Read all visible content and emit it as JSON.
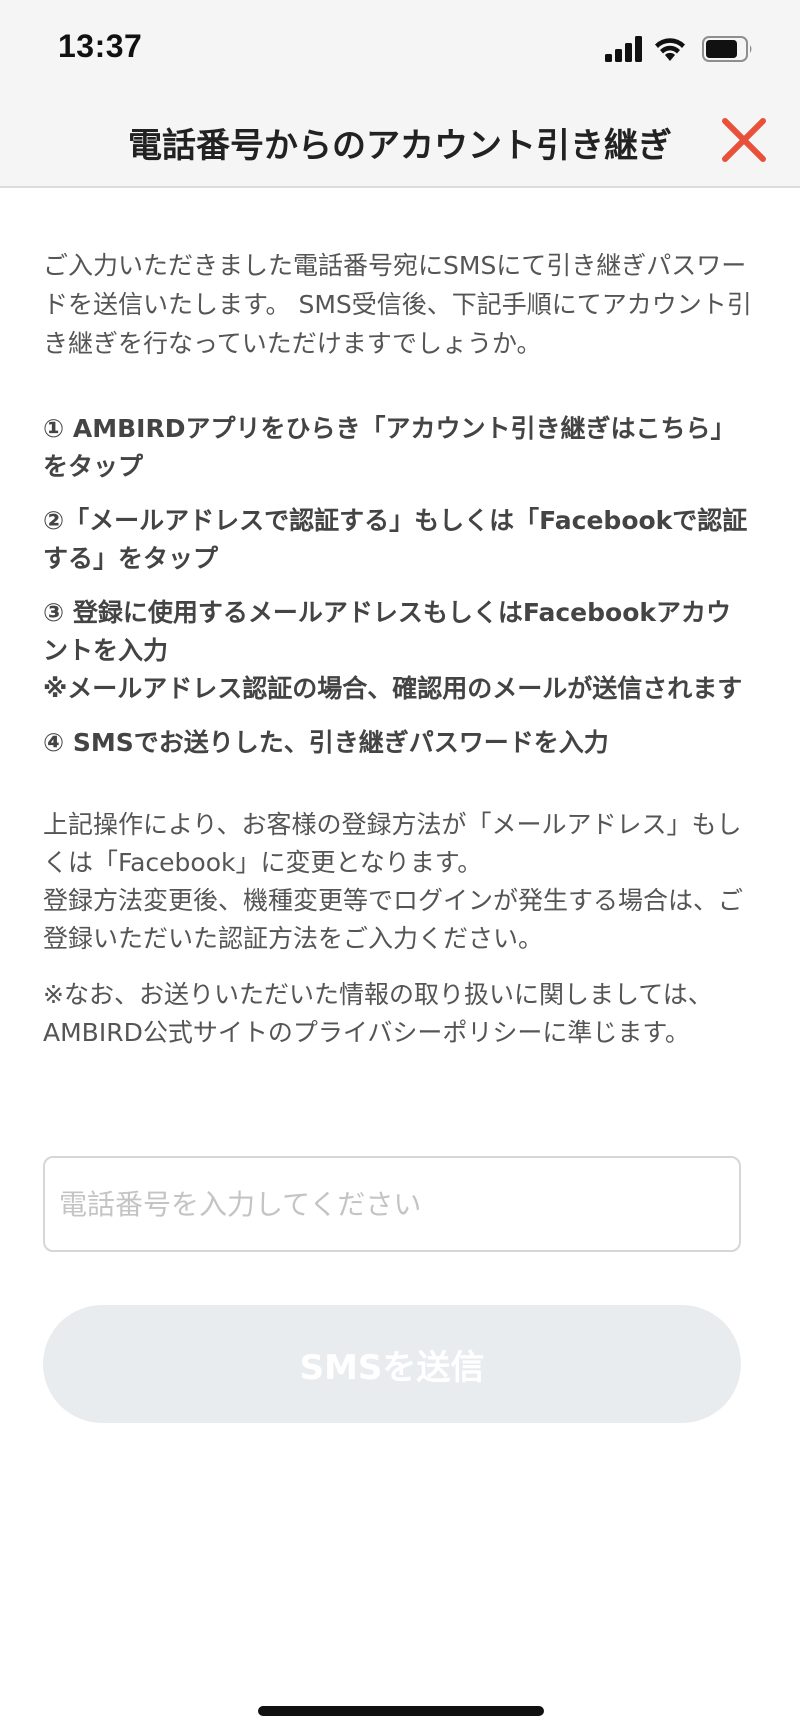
{
  "status_bar": {
    "time": "13:37"
  },
  "header": {
    "title": "電話番号からのアカウント引き継ぎ",
    "close_icon": "close-icon",
    "close_color": "#e8503a"
  },
  "intro": "ご入力いただきました電話番号宛にSMSにて引き継ぎパスワードを送信いたします。 SMS受信後、下記手順にてアカウント引き継ぎを行なっていただけますでしょうか。",
  "steps": [
    "① AMBIRDアプリをひらき「アカウント引き継ぎはこちら」をタップ",
    "②「メールアドレスで認証する」もしくは「Facebookで認証する」をタップ",
    "③ 登録に使用するメールアドレスもしくはFacebookアカウントを入力",
    "※メールアドレス認証の場合、確認用のメールが送信されます",
    "④ SMSでお送りした、引き継ぎパスワードを入力"
  ],
  "notes": [
    "上記操作により、お客様の登録方法が「メールアドレス」もしくは「Facebook」に変更となります。",
    "登録方法変更後、機種変更等でログインが発生する場合は、ご登録いただいた認証方法をご入力ください。",
    "※なお、お送りいただいた情報の取り扱いに関しましては、AMBIRD公式サイトのプライバシーポリシーに準じます。"
  ],
  "phone_input": {
    "value": "",
    "placeholder": "電話番号を入力してください"
  },
  "sms_button": {
    "label": "SMSを送信",
    "background": "#e8ecef"
  }
}
